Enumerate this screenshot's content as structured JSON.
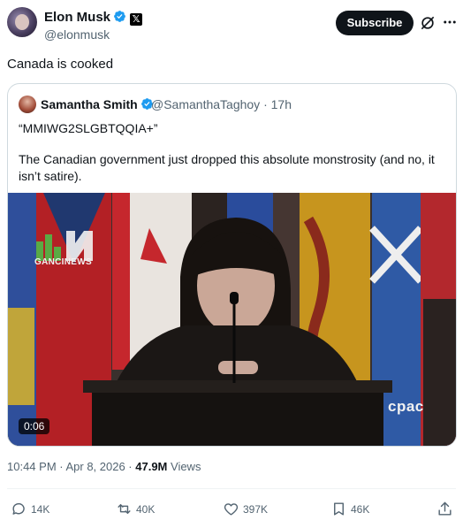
{
  "author": {
    "name": "Elon Musk",
    "handle": "@elonmusk",
    "verified_icon": "verified-badge-icon",
    "affiliate_icon": "x-logo-icon"
  },
  "header": {
    "subscribe_label": "Subscribe",
    "grok_icon": "grok-icon",
    "more_icon": "more-icon"
  },
  "tweet": {
    "text": "Canada is cooked"
  },
  "quote": {
    "name": "Samantha Smith",
    "handle": "@SamanthaTaghoy · 17h",
    "line1": "“MMIWG2SLGBTQQIA+”",
    "line2": "The Canadian government just dropped this absolute monstrosity (and no, it isn’t satire).",
    "video": {
      "duration": "0:06",
      "watermark": "cpac",
      "news_logo_text": "GANCINEWS"
    }
  },
  "meta": {
    "time": "10:44 PM · Apr 8, 2026 · ",
    "views_count": "47.9M",
    "views_label": " Views"
  },
  "actions": {
    "reply": "14K",
    "repost": "40K",
    "like": "397K",
    "bookmark": "46K"
  },
  "colors": {
    "text": "#0f1419",
    "secondary": "#536471",
    "verified": "#1d9bf0",
    "border": "#cfd9de"
  }
}
